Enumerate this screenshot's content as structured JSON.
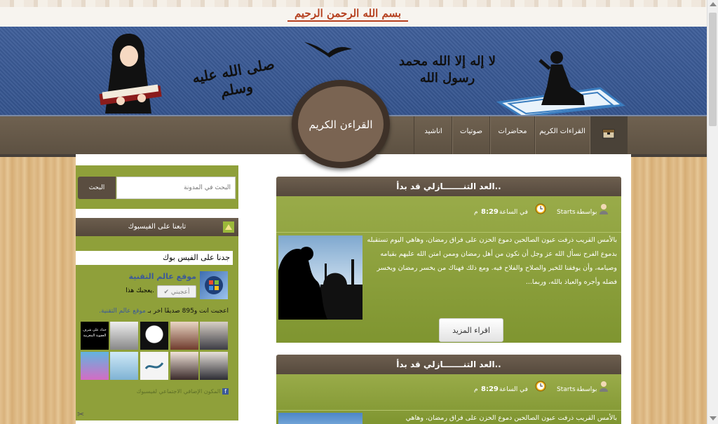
{
  "header": {
    "basmala": "بسم الله الرحمن الرحيم",
    "calligraphy_left": "صلى الله عليه وسلم",
    "calligraphy_right": "لا إله إلا الله محمد رسول الله"
  },
  "logo": {
    "title": "القراءن الكريم"
  },
  "nav": {
    "items": [
      {
        "label": "القراءات الكريم"
      },
      {
        "label": "محاضرات"
      },
      {
        "label": "صوتيات"
      },
      {
        "label": "اناشيد"
      }
    ]
  },
  "sidebar": {
    "search": {
      "placeholder": "البحث في المدونة",
      "button": "البحث"
    },
    "facebook_heading": "تابعنا على الفيسبوك",
    "fb_widget": {
      "title": "جدنا على الفيس بوك",
      "page_name": "موقع عالم التقنية",
      "like_button": "أعجبني",
      "like_text": "يعجبك هذا.",
      "likes_summary": "أعجبت أنت و895 صديقًا آخر بـ",
      "likes_page": "موقع عالم التقنية.",
      "face_caption": "حداد على شرف العفوية المغربية",
      "plugin_text": "المكون الإضافي الاجتماعي لفيسبوك"
    }
  },
  "posts": [
    {
      "title": "العد التنـــــــازلي قد بدأ..",
      "author": "Starts",
      "by_label": "بواسطة",
      "time_label": "في الساعة",
      "time": "8:29",
      "ampm": "م",
      "excerpt": "بالأمس القريب ذرفت عيون الصالحين دموع الحزن على فراق رمضان، وهاهي اليوم تستقبله بدموع الفرح نسأل الله عز وجل أن نكون من أهل رمضان وممن امتن الله عليهم بقيامه وصيامه، وأن يوفقنا للخير والصلاح والفلاح فيه. ومع ذلك فهناك من يخسر رمضان ويخسر فضله وأجره والعياذ بالله، وربما...",
      "read_more": "اقراء المزيد"
    },
    {
      "title": "العد التنـــــــازلي قد بدأ..",
      "author": "Starts",
      "by_label": "بواسطة",
      "time_label": "في الساعة",
      "time": "8:29",
      "ampm": "م",
      "excerpt": "بالأمس القريب ذرفت عيون الصالحين دموع الحزن على فراق رمضان، وهاهي"
    }
  ],
  "colors": {
    "banner_blue": "#3f5f9a",
    "nav_brown": "#6f6150",
    "post_green": "#8fa03a",
    "basmala_red": "#b5401f"
  }
}
